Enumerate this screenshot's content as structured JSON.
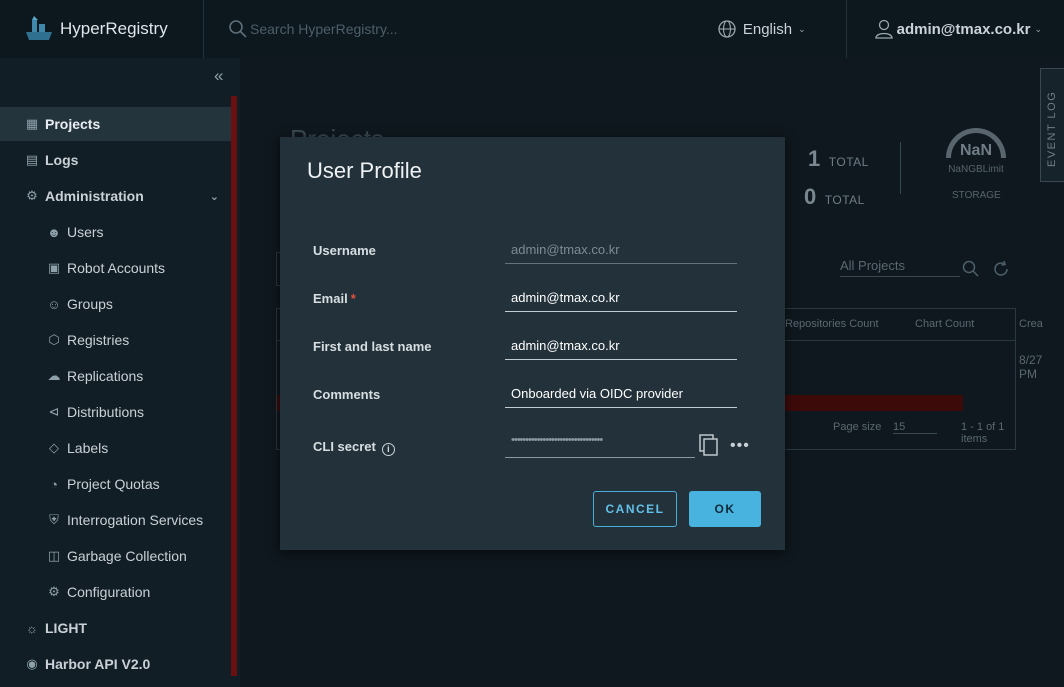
{
  "header": {
    "brand": "HyperRegistry",
    "search_placeholder": "Search HyperRegistry...",
    "language": "English",
    "user": "admin@tmax.co.kr"
  },
  "sidebar": {
    "items": [
      {
        "label": "Projects"
      },
      {
        "label": "Logs"
      },
      {
        "label": "Administration"
      },
      {
        "label": "Users"
      },
      {
        "label": "Robot Accounts"
      },
      {
        "label": "Groups"
      },
      {
        "label": "Registries"
      },
      {
        "label": "Replications"
      },
      {
        "label": "Distributions"
      },
      {
        "label": "Labels"
      },
      {
        "label": "Project Quotas"
      },
      {
        "label": "Interrogation Services"
      },
      {
        "label": "Garbage Collection"
      },
      {
        "label": "Configuration"
      },
      {
        "label": "LIGHT"
      },
      {
        "label": "Harbor API V2.0"
      }
    ]
  },
  "background": {
    "page_title": "Projects",
    "stat1_value": "1",
    "stat1_label": "TOTAL",
    "stat2_value": "0",
    "stat2_label": "TOTAL",
    "gauge_value": "NaN",
    "gauge_sub": "NaNGBLimit",
    "gauge_label": "STORAGE",
    "event_log": "EVENT LOG",
    "filter": "All Projects",
    "col_repos": "Repositories Count",
    "col_charts": "Chart Count",
    "col_created": "Crea",
    "created_cell_1": "8/27",
    "created_cell_2": "PM",
    "page_size_label": "Page size",
    "page_size_value": "15",
    "pagination": "1 - 1 of 1 items"
  },
  "modal": {
    "title": "User Profile",
    "username_label": "Username",
    "username_value": "admin@tmax.co.kr",
    "email_label": "Email",
    "email_required": "*",
    "email_value": "admin@tmax.co.kr",
    "name_label": "First and last name",
    "name_value": "admin@tmax.co.kr",
    "comments_label": "Comments",
    "comments_value": "Onboarded via OIDC provider",
    "cli_label": "CLI secret",
    "cli_value": "••••••••••••••••••••••••••••••••",
    "cancel": "CANCEL",
    "ok": "OK"
  },
  "colors": {
    "accent": "#49b3e0",
    "modal_bg": "#23323a",
    "header_bg": "#0d171e"
  }
}
